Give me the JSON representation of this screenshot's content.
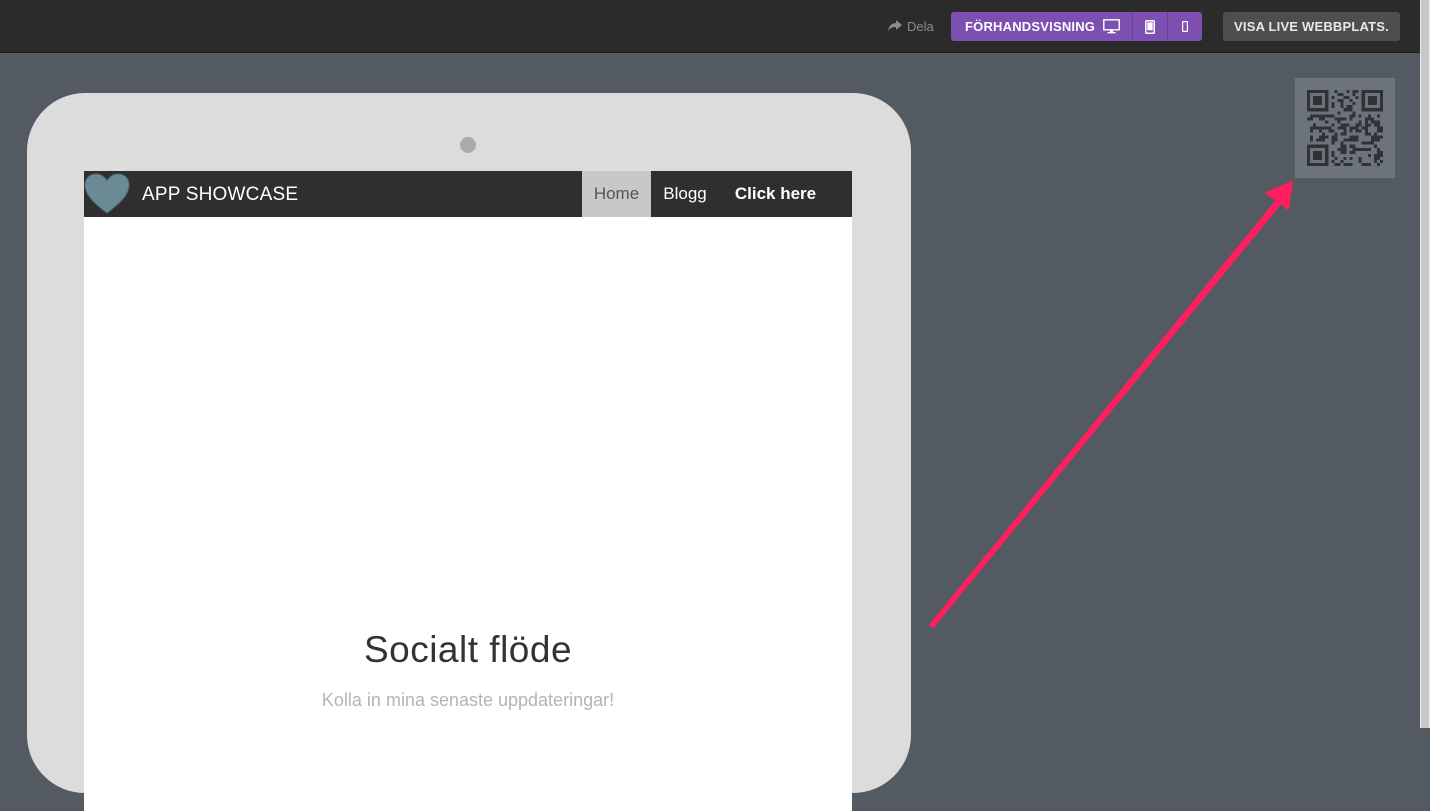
{
  "toolbar": {
    "share_label": "Dela",
    "preview_label": "FÖRHANDSVISNING",
    "live_label": "VISA LIVE WEBBPLATS."
  },
  "site": {
    "title": "APP SHOWCASE",
    "nav": {
      "home": "Home",
      "blog": "Blogg",
      "cta": "Click here"
    },
    "social_title": "Socialt flöde",
    "social_subtitle": "Kolla in mina senaste uppdateringar!"
  },
  "colors": {
    "topbar": "#2b2b2b",
    "background": "#535a62",
    "accent_purple": "#7d4fb0",
    "arrow_pink": "#ff1f5f",
    "heart": "#6a8a96"
  },
  "icons": [
    "share-icon",
    "desktop-icon",
    "tablet-icon",
    "phone-icon",
    "heart-logo",
    "qr-code",
    "annotation-arrow"
  ]
}
